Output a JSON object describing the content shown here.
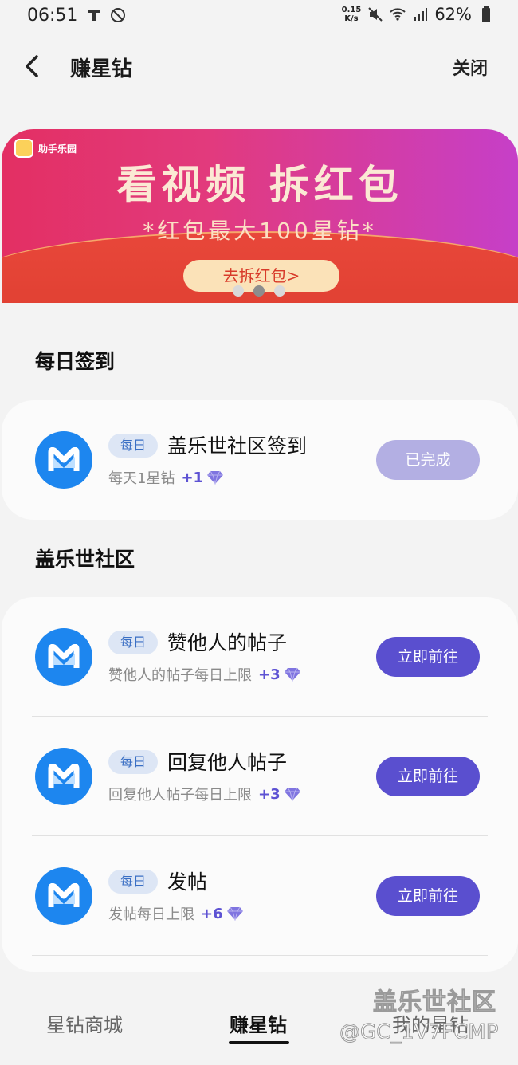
{
  "status_bar": {
    "time": "06:51",
    "net_speed_value": "0.15",
    "net_speed_unit": "K/s",
    "battery": "62%",
    "icons": [
      "sim-icon",
      "no-disturb-icon",
      "mute-icon",
      "wifi-icon",
      "signal-icon",
      "battery-icon"
    ]
  },
  "header": {
    "title": "赚星钻",
    "close_label": "关闭"
  },
  "banner": {
    "badge": "助手乐园",
    "headline": "看视频  拆红包",
    "subline": "*红包最大100星钻*",
    "cta": "去拆红包>",
    "dots_count": 3,
    "active_dot": 2
  },
  "sections": [
    {
      "heading": "每日签到",
      "tasks": [
        {
          "tag": "每日",
          "title": "盖乐世社区签到",
          "desc": "每天1星钻",
          "reward": "+1",
          "button": "已完成",
          "done": true
        }
      ]
    },
    {
      "heading": "盖乐世社区",
      "tasks": [
        {
          "tag": "每日",
          "title": "赞他人的帖子",
          "desc": "赞他人的帖子每日上限",
          "reward": "+3",
          "button": "立即前往",
          "done": false
        },
        {
          "tag": "每日",
          "title": "回复他人帖子",
          "desc": "回复他人帖子每日上限",
          "reward": "+3",
          "button": "立即前往",
          "done": false
        },
        {
          "tag": "每日",
          "title": "发帖",
          "desc": "发帖每日上限",
          "reward": "+6",
          "button": "立即前往",
          "done": false
        }
      ]
    }
  ],
  "bottom_nav": {
    "tabs": [
      "星钻商城",
      "赚星钻",
      "我的星钻"
    ],
    "active": 1
  },
  "watermark": {
    "line1": "盖乐世社区",
    "line2": "@GC_1V7FCMP"
  },
  "colors": {
    "accent": "#5a4fcf",
    "done_button": "#b3afe3",
    "app_icon": "#1d86ef",
    "reward": "#5d52d3"
  }
}
